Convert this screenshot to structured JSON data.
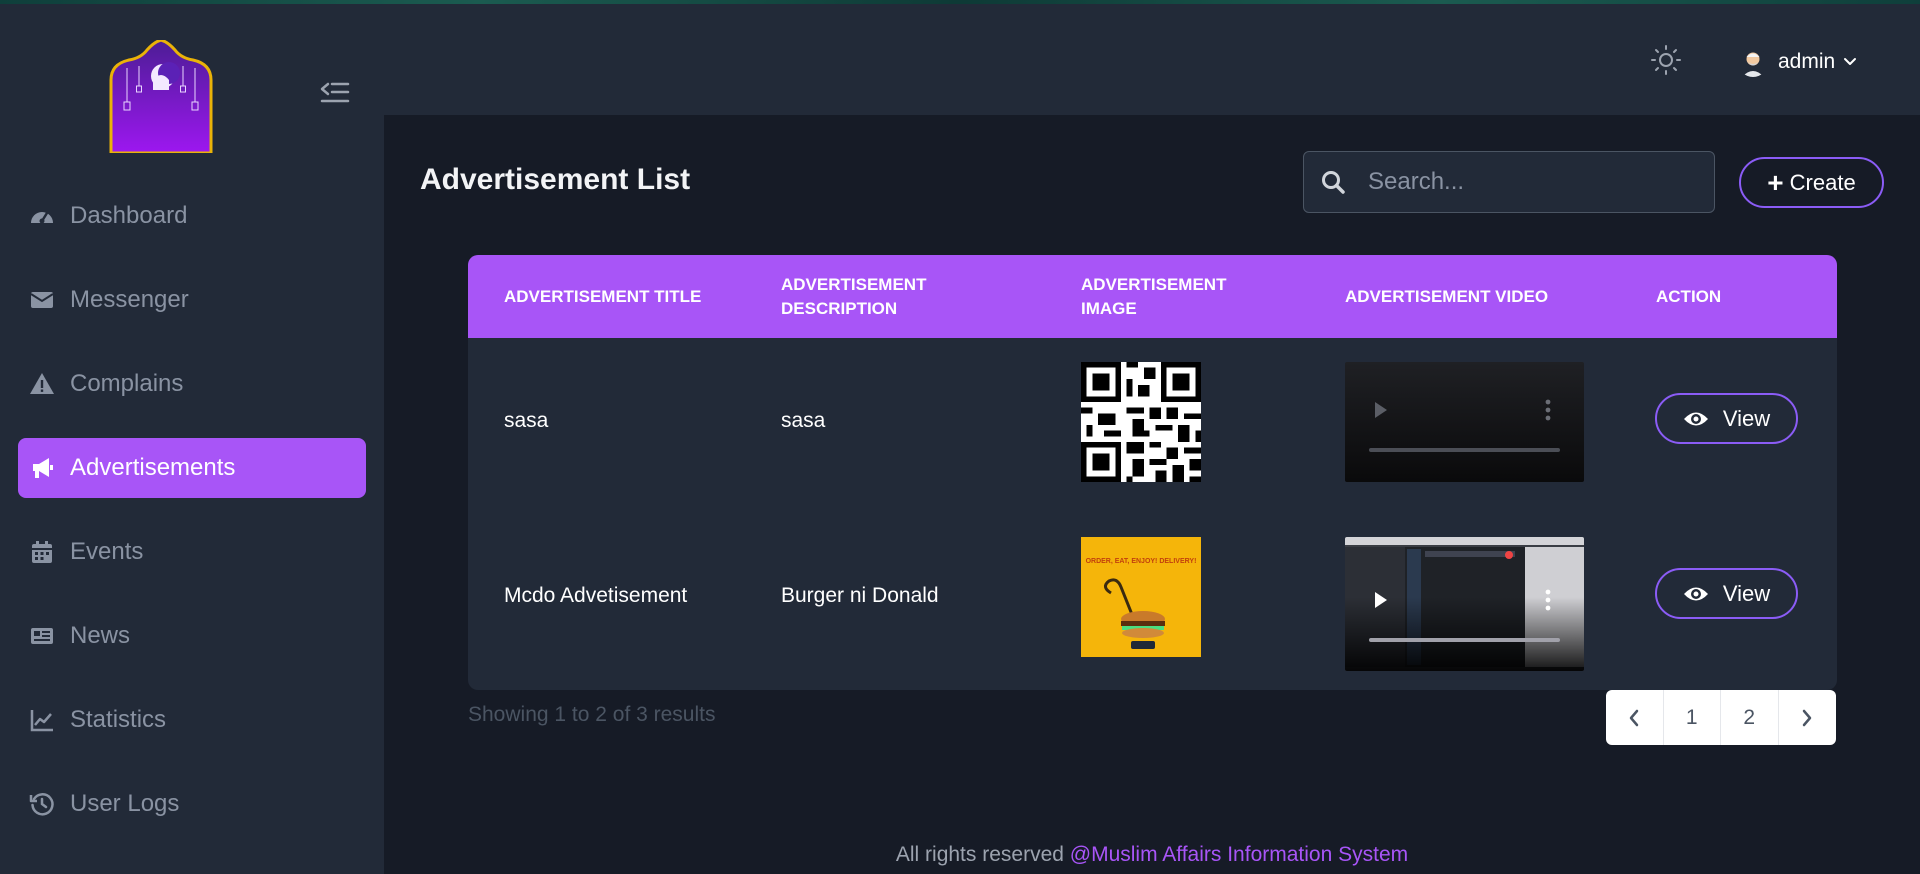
{
  "sidebar": {
    "items": [
      {
        "label": "Dashboard",
        "icon": "gauge-icon"
      },
      {
        "label": "Messenger",
        "icon": "envelope-icon"
      },
      {
        "label": "Complains",
        "icon": "warning-icon"
      },
      {
        "label": "Advertisements",
        "icon": "megaphone-icon",
        "active": true
      },
      {
        "label": "Events",
        "icon": "calendar-icon"
      },
      {
        "label": "News",
        "icon": "newspaper-icon"
      },
      {
        "label": "Statistics",
        "icon": "chart-line-icon"
      },
      {
        "label": "User Logs",
        "icon": "history-icon"
      }
    ]
  },
  "header": {
    "username": "admin"
  },
  "main": {
    "title": "Advertisement List",
    "search_placeholder": "Search...",
    "create_label": "Create",
    "table": {
      "columns": [
        "ADVERTISEMENT TITLE",
        "ADVERTISEMENT DESCRIPTION",
        "ADVERTISEMENT IMAGE",
        "ADVERTISEMENT VIDEO",
        "ACTION"
      ],
      "rows": [
        {
          "title": "sasa",
          "description": "sasa",
          "image": "qr-code-image",
          "video": "video-player",
          "action": "View"
        },
        {
          "title": "Mcdo Advetisement",
          "description": "Burger ni Donald",
          "image": "burger-ad-image",
          "image_text": "ORDER, EAT, ENJOY! DELIVERY!",
          "video": "video-player",
          "action": "View"
        }
      ]
    },
    "showing_text": "Showing 1 to 2 of 3 results",
    "pagination": {
      "pages": [
        "1",
        "2"
      ]
    }
  },
  "footer": {
    "prefix": "All rights reserved ",
    "brand": "@Muslim Affairs Information System"
  },
  "colors": {
    "accent": "#a855f7",
    "sidebar_bg": "#222a38",
    "main_bg": "#161b26"
  }
}
